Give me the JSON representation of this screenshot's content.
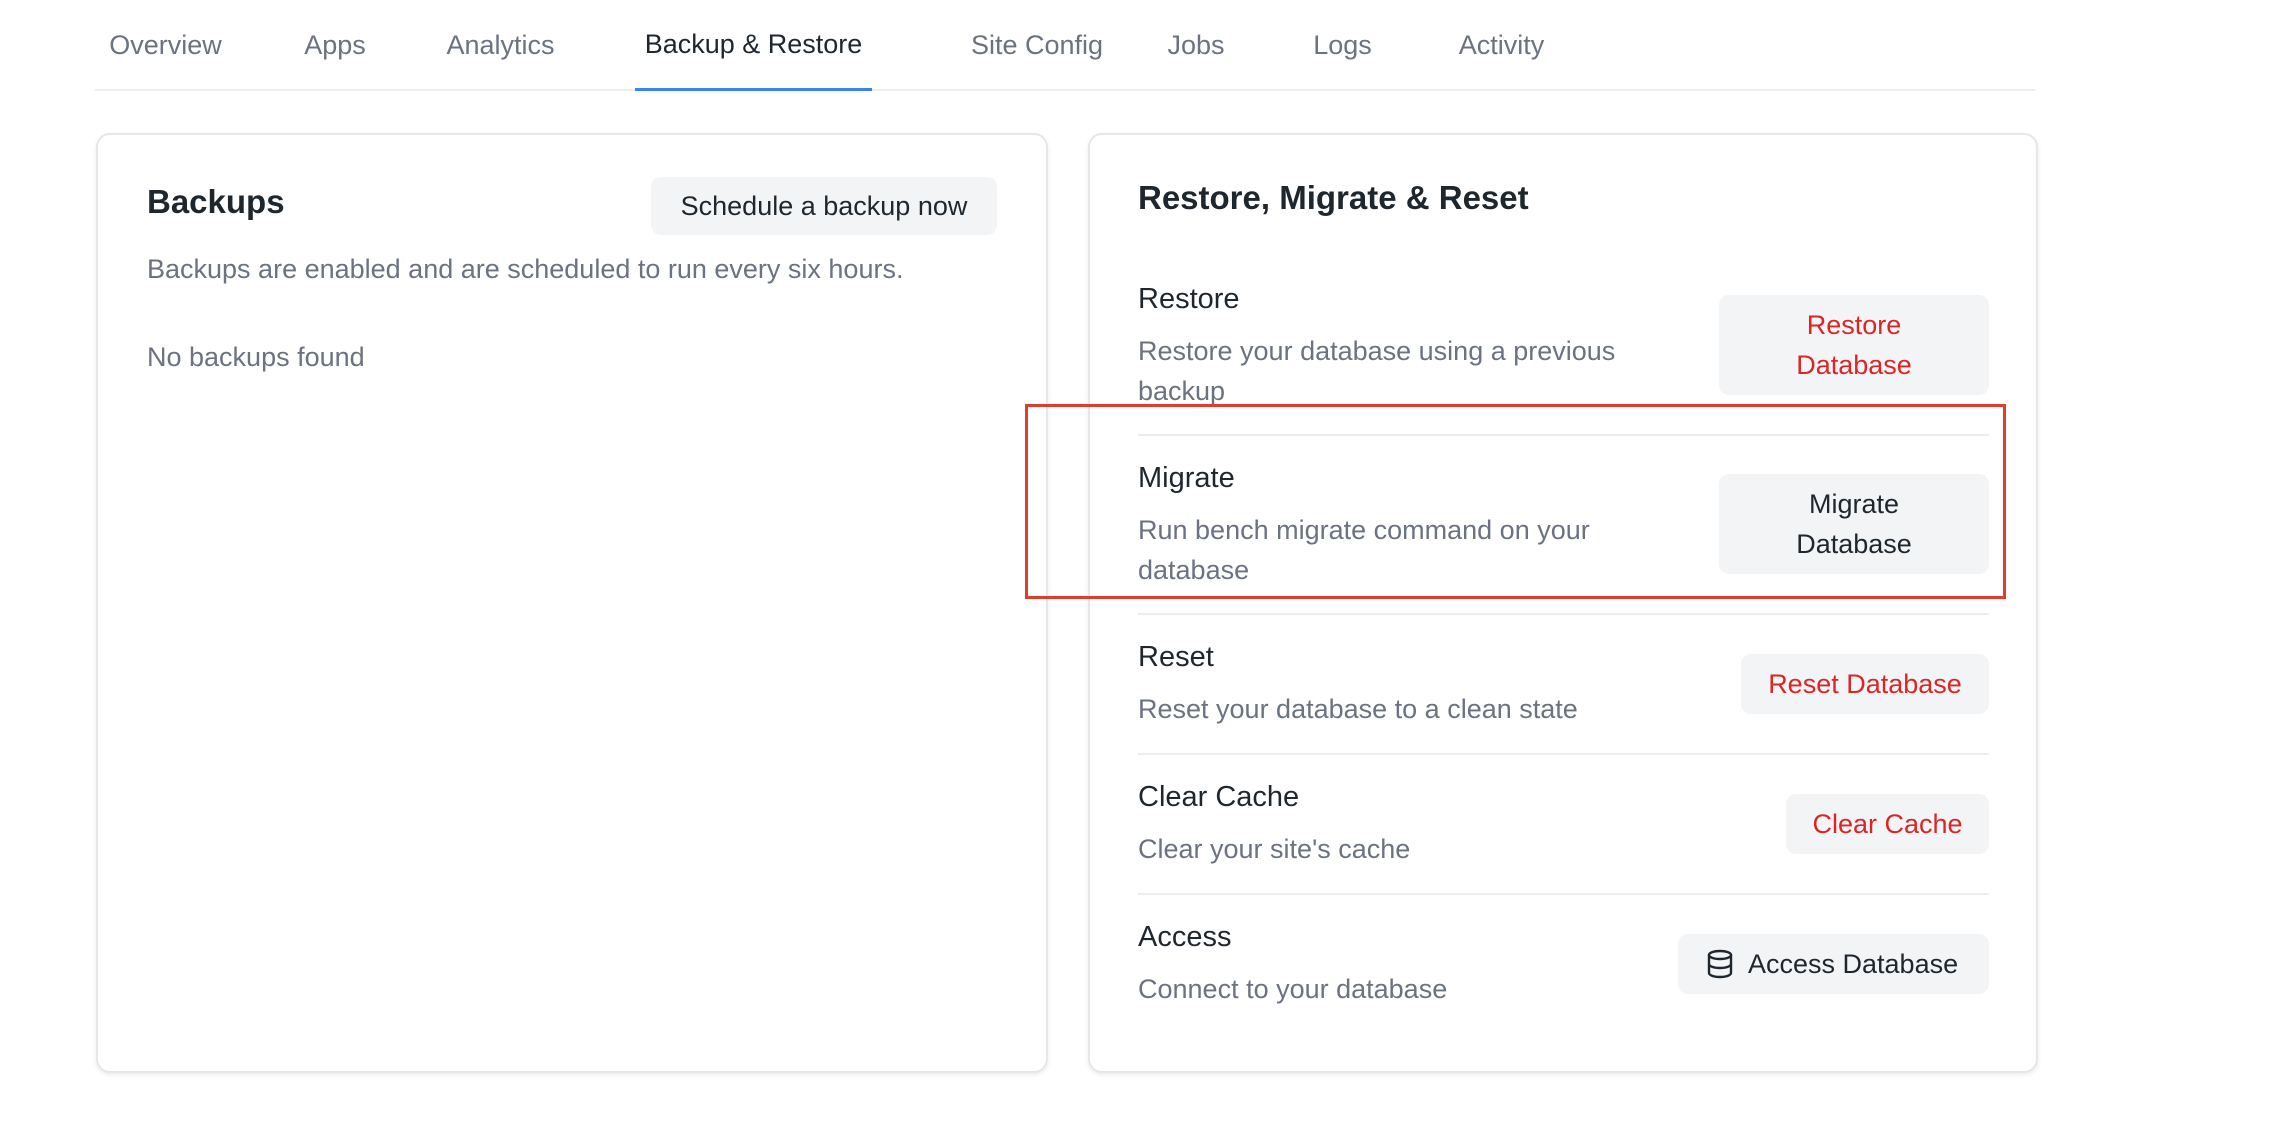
{
  "tabs": [
    {
      "label": "Overview"
    },
    {
      "label": "Apps"
    },
    {
      "label": "Analytics"
    },
    {
      "label": "Backup & Restore",
      "active": true
    },
    {
      "label": "Site Config"
    },
    {
      "label": "Jobs"
    },
    {
      "label": "Logs"
    },
    {
      "label": "Activity"
    }
  ],
  "backups": {
    "title": "Backups",
    "schedule_button": "Schedule a backup now",
    "status": "Backups are enabled and are scheduled to run every six hours.",
    "empty": "No backups found"
  },
  "restore_panel": {
    "title": "Restore, Migrate & Reset",
    "rows": [
      {
        "title": "Restore",
        "description": "Restore your database using a previous backup",
        "button": "Restore Database",
        "danger": true
      },
      {
        "title": "Migrate",
        "description": "Run bench migrate command on your database",
        "button": "Migrate Database",
        "danger": false,
        "highlighted": true
      },
      {
        "title": "Reset",
        "description": "Reset your database to a clean state",
        "button": "Reset Database",
        "danger": true
      },
      {
        "title": "Clear Cache",
        "description": "Clear your site's cache",
        "button": "Clear Cache",
        "danger": true
      },
      {
        "title": "Access",
        "description": "Connect to your database",
        "button": "Access Database",
        "danger": false,
        "icon": "database-icon"
      }
    ]
  },
  "colors": {
    "accent": "#3b82f6",
    "danger": "#dc2626",
    "highlight": "#e03e2d"
  }
}
